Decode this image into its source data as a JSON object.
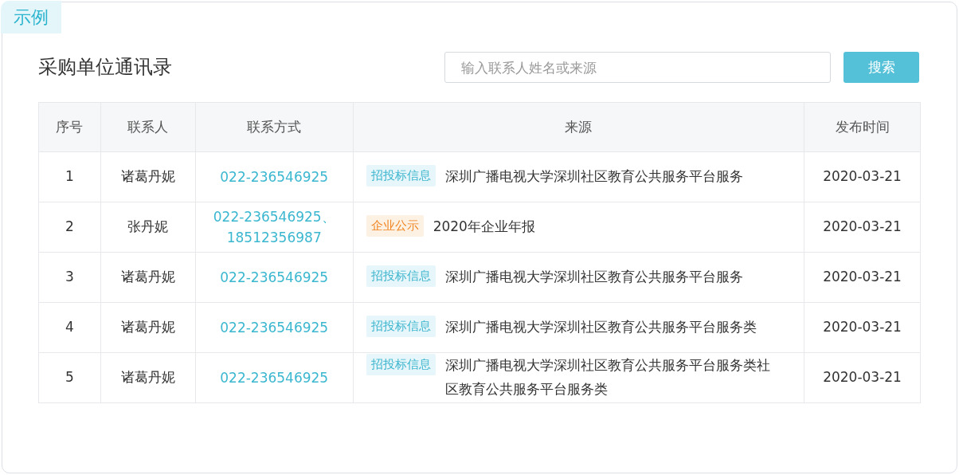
{
  "corner_tag": "示例",
  "title": "采购单位通讯录",
  "search": {
    "placeholder": "输入联系人姓名或来源",
    "button": "搜索"
  },
  "table": {
    "columns": [
      "序号",
      "联系人",
      "联系方式",
      "来源",
      "发布时间"
    ],
    "rows": [
      {
        "index": "1",
        "contact": "诸葛丹妮",
        "phone": "022-236546925",
        "tag": {
          "text": "招投标信息",
          "kind": "bid"
        },
        "source": "深圳广播电视大学深圳社区教育公共服务平台服务",
        "date": "2020-03-21"
      },
      {
        "index": "2",
        "contact": "张丹妮",
        "phone": "022-236546925、\n18512356987",
        "tag": {
          "text": "企业公示",
          "kind": "company"
        },
        "source": "2020年企业年报",
        "date": "2020-03-21"
      },
      {
        "index": "3",
        "contact": "诸葛丹妮",
        "phone": "022-236546925",
        "tag": {
          "text": "招投标信息",
          "kind": "bid"
        },
        "source": "深圳广播电视大学深圳社区教育公共服务平台服务",
        "date": "2020-03-21"
      },
      {
        "index": "4",
        "contact": "诸葛丹妮",
        "phone": "022-236546925",
        "tag": {
          "text": "招投标信息",
          "kind": "bid"
        },
        "source": "深圳广播电视大学深圳社区教育公共服务平台服务类",
        "date": "2020-03-21"
      },
      {
        "index": "5",
        "contact": "诸葛丹妮",
        "phone": "022-236546925",
        "tag": {
          "text": "招投标信息",
          "kind": "bid"
        },
        "source": "深圳广播电视大学深圳社区教育公共服务平台服务类社区教育公共服务平台服务类",
        "date": "2020-03-21"
      }
    ]
  }
}
